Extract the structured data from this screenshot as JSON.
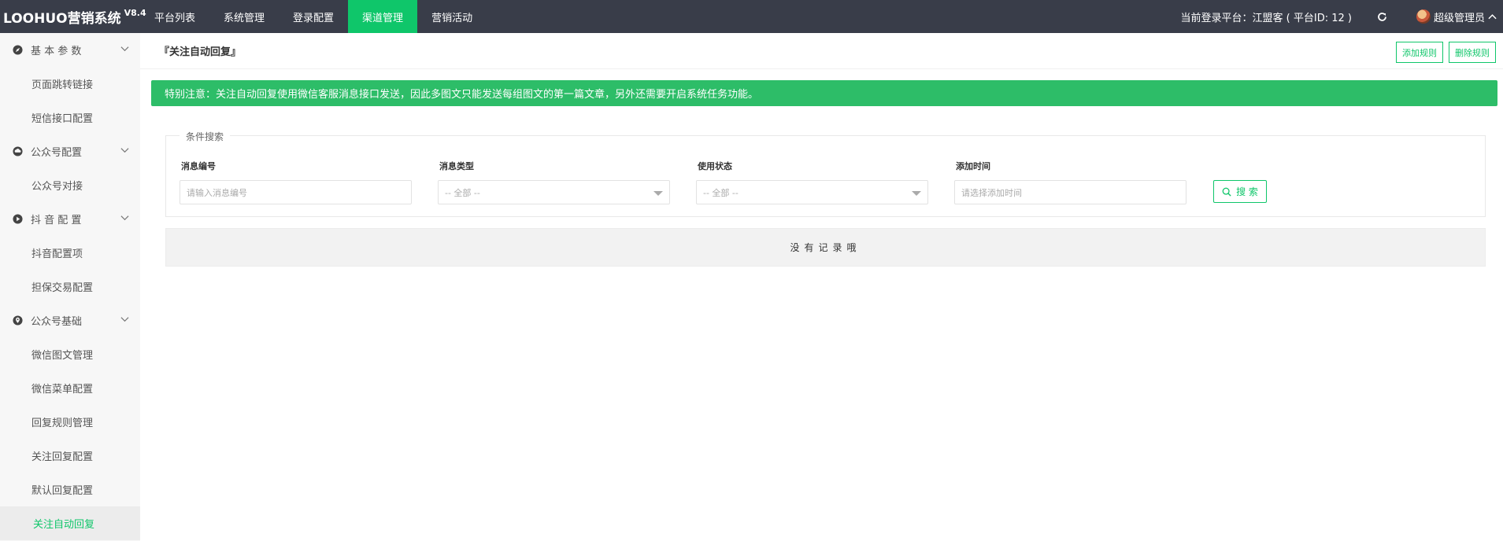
{
  "app": {
    "brand": "LOOHUO营销系统",
    "version": "V8.4"
  },
  "nav": {
    "items": [
      {
        "label": "平台列表"
      },
      {
        "label": "系统管理"
      },
      {
        "label": "登录配置"
      },
      {
        "label": "渠道管理",
        "active": true
      },
      {
        "label": "营销活动"
      }
    ]
  },
  "topRight": {
    "platform_info": "当前登录平台：江盟客 ( 平台ID: 12 )",
    "user_name": "超级管理员",
    "refresh_icon": "refresh-icon",
    "chevron_icon": "chevron-up-icon"
  },
  "sidebar": {
    "groups": [
      {
        "label": "基 本 参 数",
        "icon": "compass-icon",
        "items": [
          "页面跳转链接",
          "短信接口配置"
        ]
      },
      {
        "label": "公众号配置",
        "icon": "cloud-icon",
        "items": [
          "公众号对接"
        ]
      },
      {
        "label": "抖 音 配 置",
        "icon": "play-circle-icon",
        "items": [
          "抖音配置项",
          "担保交易配置"
        ]
      },
      {
        "label": "公众号基础",
        "icon": "location-icon",
        "items": [
          "微信图文管理",
          "微信菜单配置",
          "回复规则管理",
          "关注回复配置",
          "默认回复配置",
          "关注自动回复"
        ]
      }
    ],
    "active_item": "关注自动回复"
  },
  "page": {
    "title": "『关注自动回复』",
    "add_button": "添加规则",
    "delete_button": "删除规则",
    "notice": "特别注意：关注自动回复使用微信客服消息接口发送，因此多图文只能发送每组图文的第一篇文章，另外还需要开启系统任务功能。"
  },
  "search": {
    "legend": "条件搜索",
    "fields": [
      {
        "label": "消息编号",
        "placeholder": "请输入消息编号",
        "type": "text"
      },
      {
        "label": "消息类型",
        "value": "-- 全部 --",
        "type": "select"
      },
      {
        "label": "使用状态",
        "value": "-- 全部 --",
        "type": "select"
      },
      {
        "label": "添加时间",
        "placeholder": "请选择添加时间",
        "type": "text"
      }
    ],
    "button": "搜 索"
  },
  "table": {
    "empty": "没有记录哦"
  },
  "colors": {
    "accent": "#0fc66a",
    "topbar": "#393d49",
    "notice": "#2dbd68"
  }
}
